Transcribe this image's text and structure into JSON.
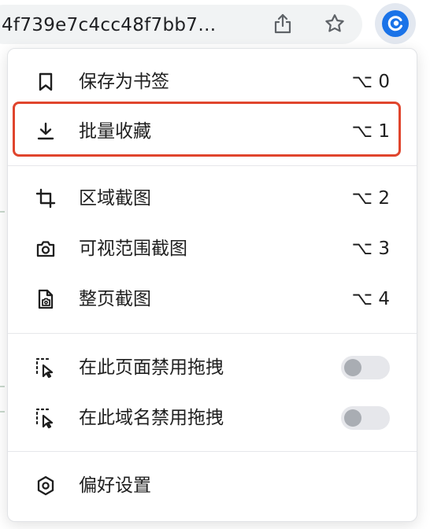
{
  "browser": {
    "url_text": "4f739e7c4cc48f7bb7…",
    "icons": [
      "share-icon",
      "star-icon",
      "extension-icon"
    ]
  },
  "menu": {
    "items": [
      {
        "id": "bookmark",
        "icon": "bookmark-icon",
        "label": "保存为书签",
        "shortcut": "⌥ 0"
      },
      {
        "id": "batch",
        "icon": "download-icon",
        "label": "批量收藏",
        "shortcut": "⌥ 1",
        "highlighted": true
      },
      {
        "id": "region",
        "icon": "crop-icon",
        "label": "区域截图",
        "shortcut": "⌥ 2"
      },
      {
        "id": "visible",
        "icon": "camera-icon",
        "label": "可视范围截图",
        "shortcut": "⌥ 3"
      },
      {
        "id": "fullpage",
        "icon": "page-capture-icon",
        "label": "整页截图",
        "shortcut": "⌥ 4"
      },
      {
        "id": "page-drag",
        "icon": "drag-select-icon",
        "label": "在此页面禁用拖拽",
        "toggle": false
      },
      {
        "id": "domain-drag",
        "icon": "drag-select-icon",
        "label": "在此域名禁用拖拽",
        "toggle": false
      },
      {
        "id": "prefs",
        "icon": "settings-icon",
        "label": "偏好设置"
      }
    ]
  },
  "colors": {
    "highlight_border": "#e0452d",
    "brand_blue": "#1a73e8",
    "toggle_off_track": "#e6e7eb",
    "toggle_off_knob": "#a9adb3"
  }
}
